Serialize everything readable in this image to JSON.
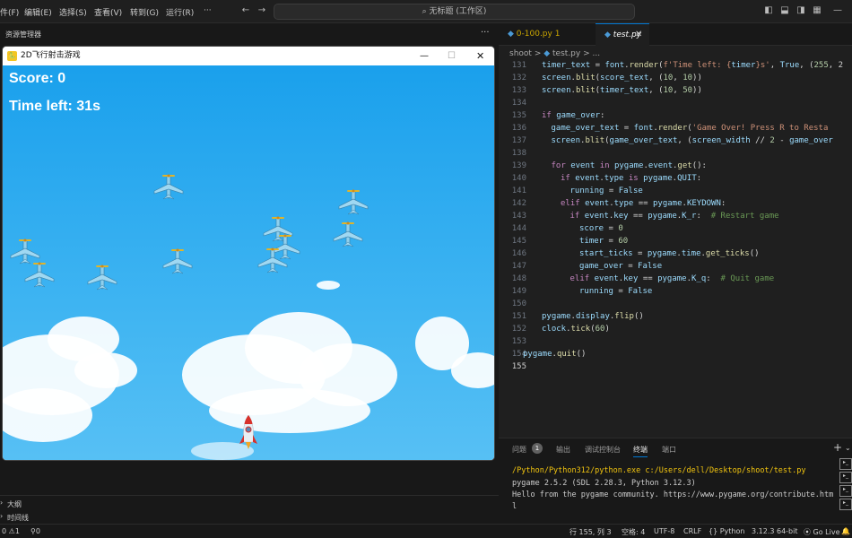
{
  "menubar": [
    "件(F)",
    "编辑(E)",
    "选择(S)",
    "查看(V)",
    "转到(G)",
    "运行(R)",
    "···"
  ],
  "search": "无标题 (工作区)",
  "explorer_title": "资源管理器",
  "tabs": [
    {
      "label": "0-100.py 1"
    },
    {
      "label": "test.py"
    }
  ],
  "breadcrumb": [
    "shoot",
    ">",
    "test.py",
    ">",
    "..."
  ],
  "code_lines": [
    {
      "n": "131",
      "html": "<span class='vr'>timer_text</span> <span class='pl'>=</span> <span class='vr'>font</span><span class='pl'>.</span><span class='fn'>render</span><span class='pl'>(</span><span class='st'>f'Time left: {</span><span class='vr'>timer</span><span class='st'>}s'</span><span class='pl'>, </span><span class='vr'>True</span><span class='pl'>, (</span><span class='nm'>255</span><span class='pl'>, 2</span>",
      "i": 2
    },
    {
      "n": "132",
      "html": "<span class='vr'>screen</span><span class='pl'>.</span><span class='fn'>blit</span><span class='pl'>(</span><span class='vr'>score_text</span><span class='pl'>, (</span><span class='nm'>10</span><span class='pl'>, </span><span class='nm'>10</span><span class='pl'>))</span>",
      "i": 2
    },
    {
      "n": "133",
      "html": "<span class='vr'>screen</span><span class='pl'>.</span><span class='fn'>blit</span><span class='pl'>(</span><span class='vr'>timer_text</span><span class='pl'>, (</span><span class='nm'>10</span><span class='pl'>, </span><span class='nm'>50</span><span class='pl'>))</span>",
      "i": 2
    },
    {
      "n": "134",
      "html": "",
      "i": 0
    },
    {
      "n": "135",
      "html": "<span class='kw'>if</span> <span class='vr'>game_over</span><span class='pl'>:</span>",
      "i": 2
    },
    {
      "n": "136",
      "html": "<span class='vr'>game_over_text</span> <span class='pl'>=</span> <span class='vr'>font</span><span class='pl'>.</span><span class='fn'>render</span><span class='pl'>(</span><span class='st'>'Game Over! Press R to Resta</span>",
      "i": 3
    },
    {
      "n": "137",
      "html": "<span class='vr'>screen</span><span class='pl'>.</span><span class='fn'>blit</span><span class='pl'>(</span><span class='vr'>game_over_text</span><span class='pl'>, (</span><span class='vr'>screen_width</span> <span class='pl'>//</span> <span class='nm'>2</span> <span class='pl'>-</span> <span class='vr'>game_over</span>",
      "i": 3
    },
    {
      "n": "138",
      "html": "",
      "i": 0
    },
    {
      "n": "139",
      "html": "<span class='kw'>for</span> <span class='vr'>event</span> <span class='kw'>in</span> <span class='vr'>pygame</span><span class='pl'>.</span><span class='vr'>event</span><span class='pl'>.</span><span class='fn'>get</span><span class='pl'>():</span>",
      "i": 3
    },
    {
      "n": "140",
      "html": "<span class='kw'>if</span> <span class='vr'>event</span><span class='pl'>.</span><span class='vr'>type</span> <span class='kw'>is</span> <span class='vr'>pygame</span><span class='pl'>.</span><span class='vr'>QUIT</span><span class='pl'>:</span>",
      "i": 4
    },
    {
      "n": "141",
      "html": "<span class='vr'>running</span> <span class='pl'>=</span> <span class='vr'>False</span>",
      "i": 5
    },
    {
      "n": "142",
      "html": "<span class='kw'>elif</span> <span class='vr'>event</span><span class='pl'>.</span><span class='vr'>type</span> <span class='pl'>==</span> <span class='vr'>pygame</span><span class='pl'>.</span><span class='vr'>KEYDOWN</span><span class='pl'>:</span>",
      "i": 4
    },
    {
      "n": "143",
      "html": "<span class='kw'>if</span> <span class='vr'>event</span><span class='pl'>.</span><span class='vr'>key</span> <span class='pl'>==</span> <span class='vr'>pygame</span><span class='pl'>.</span><span class='vr'>K_r</span><span class='pl'>:</span>  <span class='cm'># Restart game</span>",
      "i": 5
    },
    {
      "n": "144",
      "html": "<span class='vr'>score</span> <span class='pl'>=</span> <span class='nm'>0</span>",
      "i": 6
    },
    {
      "n": "145",
      "html": "<span class='vr'>timer</span> <span class='pl'>=</span> <span class='nm'>60</span>",
      "i": 6
    },
    {
      "n": "146",
      "html": "<span class='vr'>start_ticks</span> <span class='pl'>=</span> <span class='vr'>pygame</span><span class='pl'>.</span><span class='vr'>time</span><span class='pl'>.</span><span class='fn'>get_ticks</span><span class='pl'>()</span>",
      "i": 6
    },
    {
      "n": "147",
      "html": "<span class='vr'>game_over</span> <span class='pl'>=</span> <span class='vr'>False</span>",
      "i": 6
    },
    {
      "n": "148",
      "html": "<span class='kw'>elif</span> <span class='vr'>event</span><span class='pl'>.</span><span class='vr'>key</span> <span class='pl'>==</span> <span class='vr'>pygame</span><span class='pl'>.</span><span class='vr'>K_q</span><span class='pl'>:</span>  <span class='cm'># Quit game</span>",
      "i": 5
    },
    {
      "n": "149",
      "html": "<span class='vr'>running</span> <span class='pl'>=</span> <span class='vr'>False</span>",
      "i": 6
    },
    {
      "n": "150",
      "html": "",
      "i": 0
    },
    {
      "n": "151",
      "html": "<span class='vr'>pygame</span><span class='pl'>.</span><span class='vr'>display</span><span class='pl'>.</span><span class='fn'>flip</span><span class='pl'>()</span>",
      "i": 2
    },
    {
      "n": "152",
      "html": "<span class='vr'>clock</span><span class='pl'>.</span><span class='fn'>tick</span><span class='pl'>(</span><span class='nm'>60</span><span class='pl'>)</span>",
      "i": 2
    },
    {
      "n": "153",
      "html": "",
      "i": 0
    },
    {
      "n": "154",
      "html": "<span class='vr'>pygame</span><span class='pl'>.</span><span class='fn'>quit</span><span class='pl'>()</span>",
      "i": 0
    },
    {
      "n": "155",
      "html": "",
      "i": 0
    }
  ],
  "panel": {
    "tabs": [
      "问题",
      "输出",
      "调试控制台",
      "终端",
      "端口"
    ],
    "problems_count": "1",
    "terminal": [
      "/Python/Python312/python.exe c:/Users/dell/Desktop/shoot/test.py",
      "pygame 2.5.2 (SDL 2.28.3, Python 3.12.3)",
      "Hello from the pygame community. https://www.pygame.org/contribute.htm",
      "l"
    ]
  },
  "outline": {
    "outline_label": "大纲",
    "timeline_label": "时间线"
  },
  "status": {
    "errors": "0",
    "warnings": "1",
    "ports": "0",
    "position": "行 155, 列 3",
    "spaces": "空格: 4",
    "encoding": "UTF-8",
    "eol": "CRLF",
    "language": "Python",
    "interpreter": "3.12.3 64-bit",
    "golive": "Go Live"
  },
  "game": {
    "title": "2D飞行射击游戏",
    "score": "Score: 0",
    "time": "Time left: 31s"
  },
  "colors": {
    "accent": "#0078d4",
    "sky": "#2aa8ef"
  }
}
